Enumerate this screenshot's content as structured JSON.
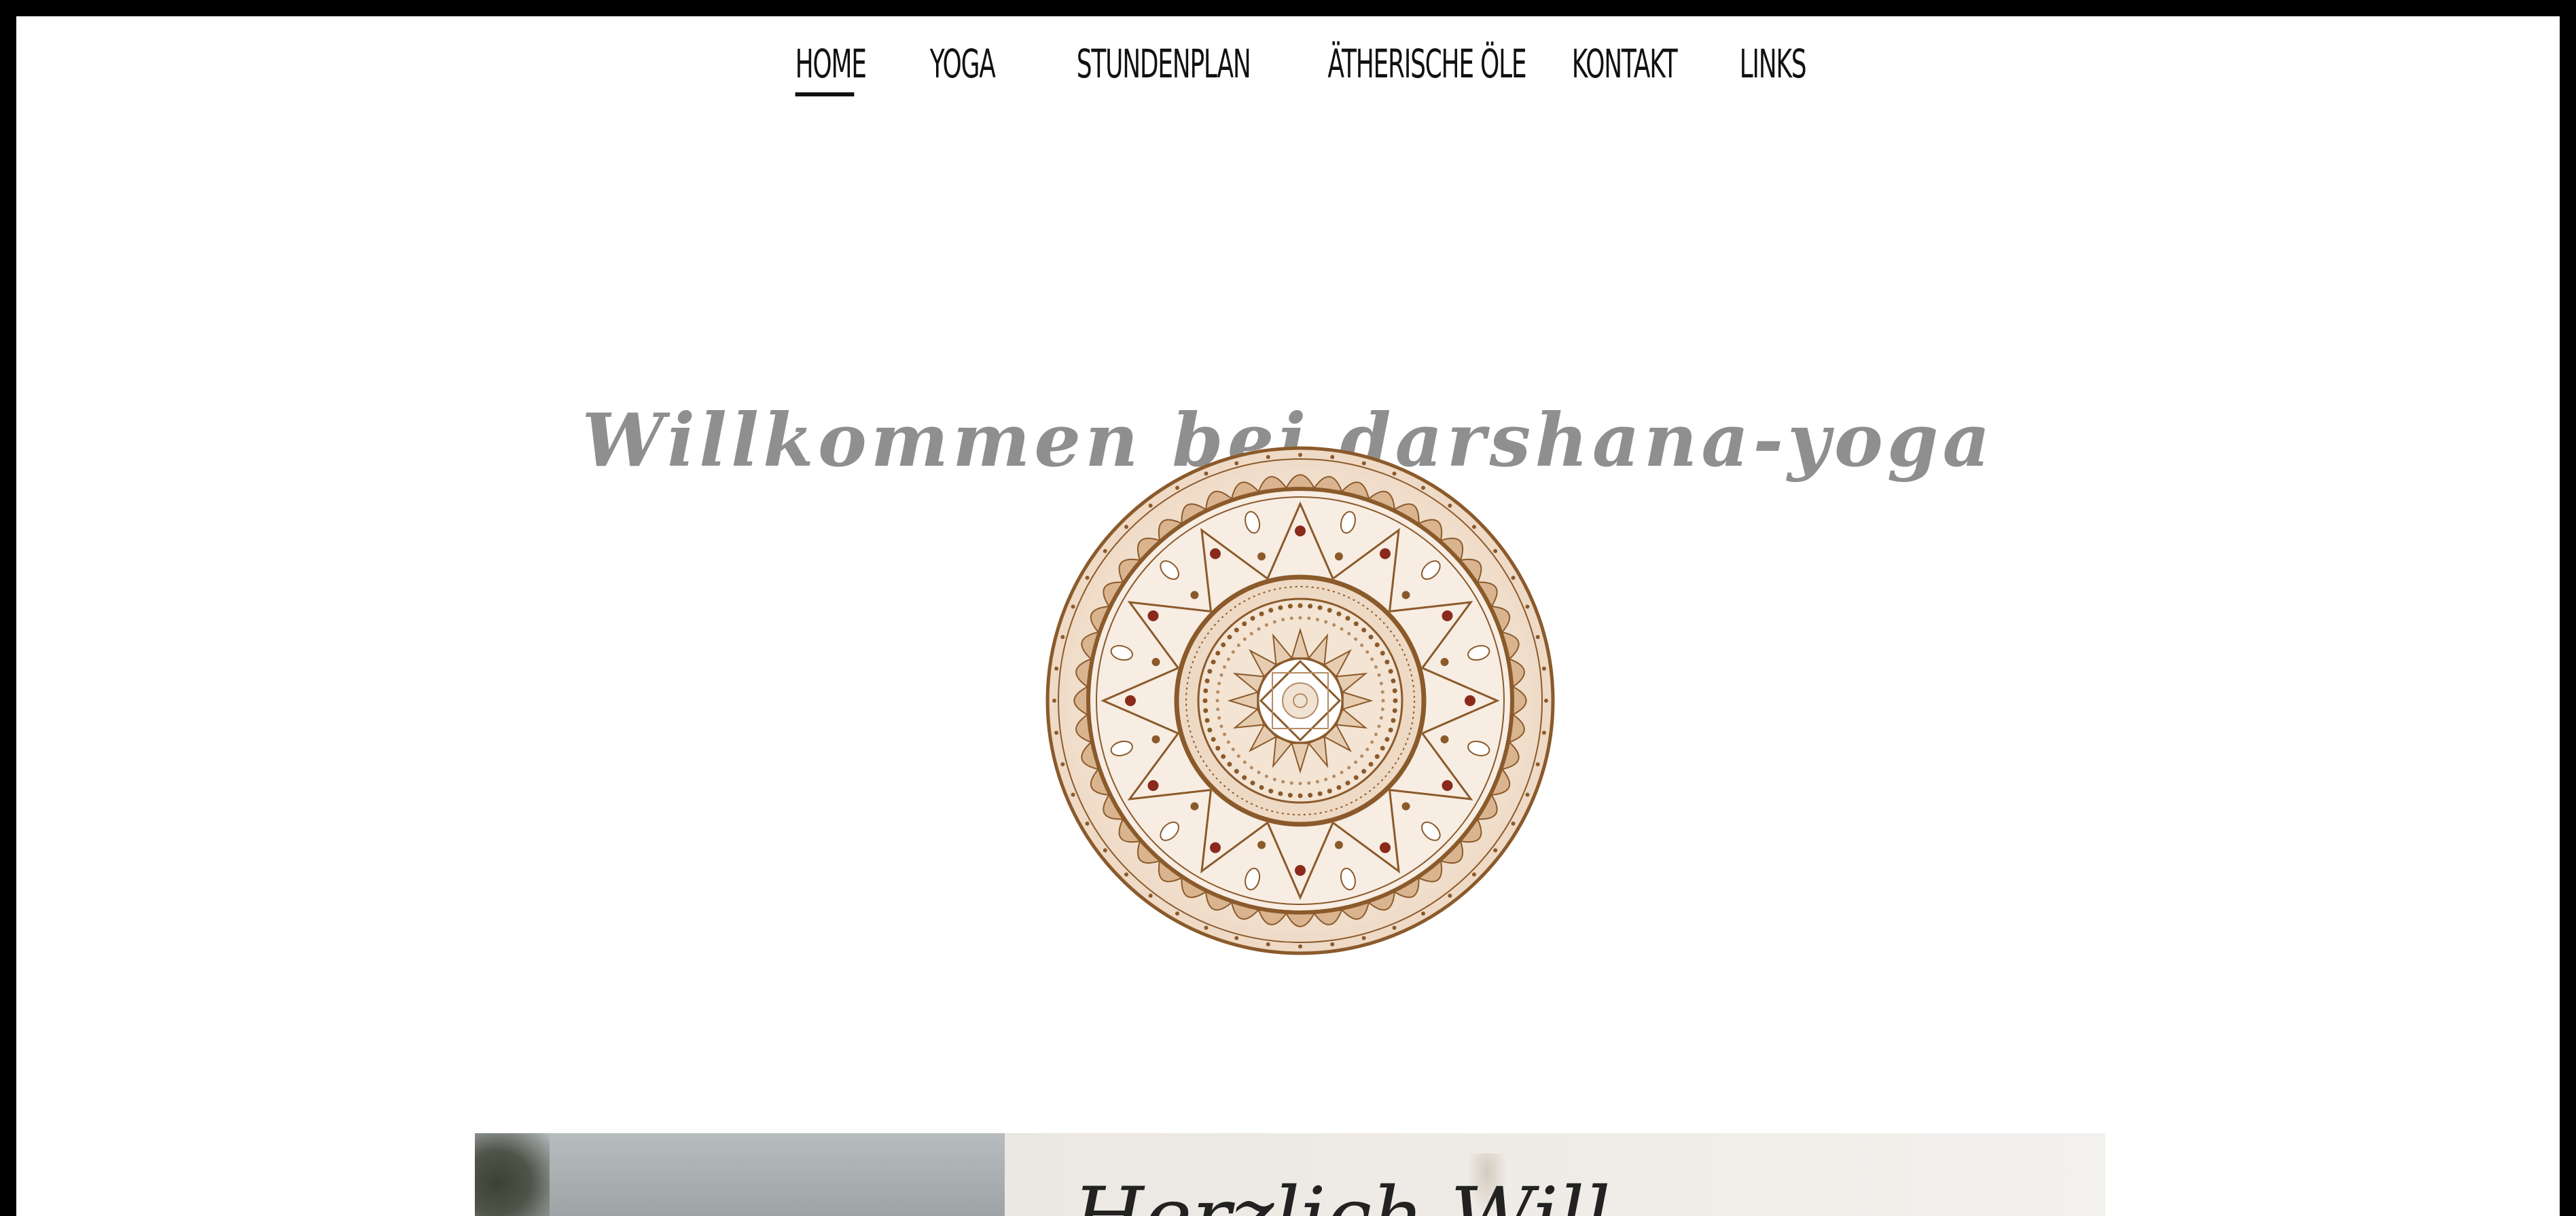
{
  "nav": {
    "items": [
      {
        "label": "HOME",
        "active": true
      },
      {
        "label": "YOGA",
        "active": false
      },
      {
        "label": "STUNDENPLAN",
        "active": false
      },
      {
        "label": "ÄTHERISCHE ÖLE",
        "active": false
      },
      {
        "label": "KONTAKT",
        "active": false
      },
      {
        "label": "LINKS",
        "active": false
      }
    ]
  },
  "hero": {
    "title": "Willkommen bei darshana-yoga"
  },
  "colors": {
    "frame": "#000000",
    "page_background": "#ffffff",
    "nav_text": "#111111",
    "hero_title": "#8f8f8f",
    "mandala_primary": "#8b5a2b",
    "mandala_light": "#f1e3d3",
    "mandala_accent": "#8a2a1c"
  },
  "bottom": {
    "heading_partial": "Herzlich Will"
  }
}
